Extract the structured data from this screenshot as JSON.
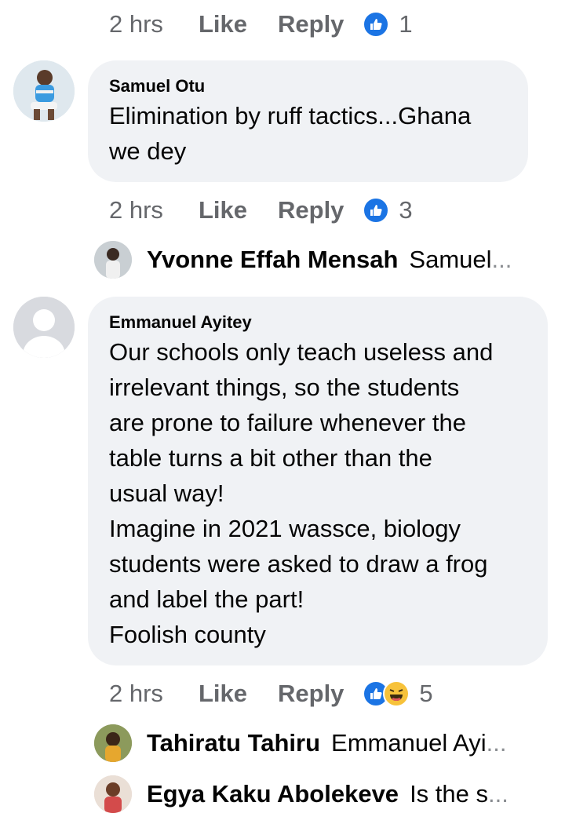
{
  "top_actions": {
    "time": "2 hrs",
    "like": "Like",
    "reply": "Reply",
    "reaction_count": "1",
    "reactions": [
      "like-icon"
    ]
  },
  "comment_1": {
    "author": "Samuel Otu",
    "text": "Elimination by ruff tactics...Ghana\nwe dey",
    "actions": {
      "time": "2 hrs",
      "like": "Like",
      "reply": "Reply",
      "reaction_count": "3",
      "reactions": [
        "like-icon"
      ]
    },
    "reply_preview": {
      "name": "Yvonne Effah Mensah",
      "snippet": "Samuel",
      "ellipsis": "..."
    }
  },
  "comment_2": {
    "author": "Emmanuel Ayitey",
    "text": "Our schools only teach useless and\nirrelevant things, so the students\nare prone to failure whenever the\ntable turns a bit other than the\nusual way!\nImagine in 2021 wassce, biology\nstudents were asked to draw a frog\nand label the part!\nFoolish county",
    "actions": {
      "time": "2 hrs",
      "like": "Like",
      "reply": "Reply",
      "reaction_count": "5",
      "reactions": [
        "like-icon",
        "haha-icon"
      ]
    },
    "replies": [
      {
        "name": "Tahiratu Tahiru",
        "snippet": "Emmanuel Ayi",
        "ellipsis": "..."
      },
      {
        "name": "Egya Kaku Abolekeve",
        "snippet": "Is the s",
        "ellipsis": "..."
      }
    ]
  },
  "colors": {
    "bubble": "#f0f2f5",
    "meta_text": "#65676b",
    "like_blue": "#1b74e4",
    "haha_yellow": "#f7c23a"
  }
}
